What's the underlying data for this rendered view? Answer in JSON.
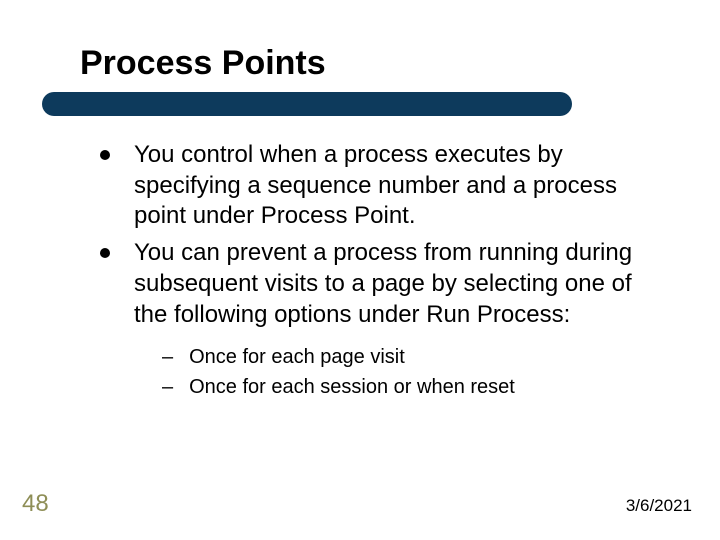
{
  "title": "Process Points",
  "bullets": [
    "You control when a process executes by specifying a sequence number and a process point under Process Point.",
    "You can prevent a process from running during subsequent visits to a page by selecting one of the following options under Run Process:"
  ],
  "sub_bullets": [
    "Once for each page visit",
    "Once for each session or when reset"
  ],
  "page_number": "48",
  "date": "3/6/2021"
}
